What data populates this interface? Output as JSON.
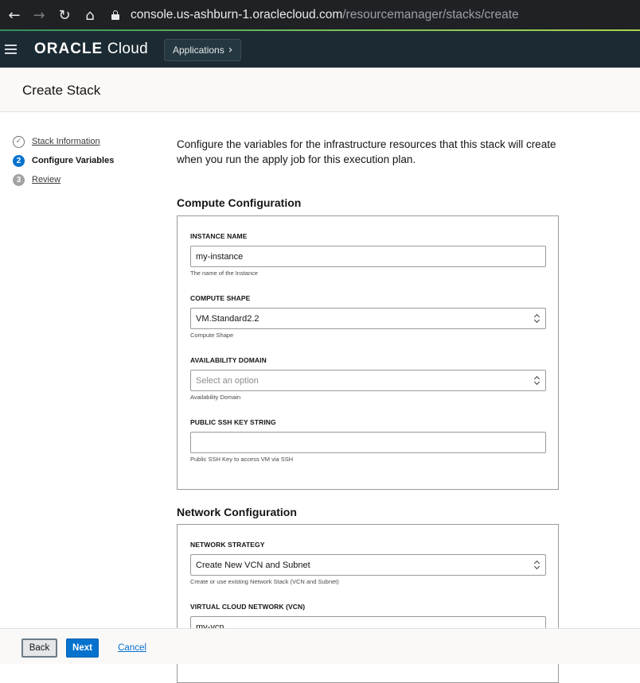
{
  "browser": {
    "back_icon": "←",
    "forward_icon": "→",
    "reload_icon": "↻",
    "home_icon": "⌂",
    "url_host": "console.us-ashburn-1.oraclecloud.com",
    "url_path": "/resourcemanager/stacks/create"
  },
  "header": {
    "brand": "ORACLE",
    "product": "Cloud",
    "applications_label": "Applications",
    "applications_chevron": "›"
  },
  "page": {
    "title": "Create Stack"
  },
  "steps": [
    {
      "number": "✓",
      "label": "Stack Information",
      "state": "completed"
    },
    {
      "number": "2",
      "label": "Configure Variables",
      "state": "active"
    },
    {
      "number": "3",
      "label": "Review",
      "state": "pending"
    }
  ],
  "intro": "Configure the variables for the infrastructure resources that this stack will create when you run the apply job for this execution plan.",
  "compute": {
    "section_title": "Compute Configuration",
    "instance_name": {
      "label": "INSTANCE NAME",
      "value": "my-instance",
      "help": "The name of the Instance"
    },
    "compute_shape": {
      "label": "COMPUTE SHAPE",
      "value": "VM.Standard2.2",
      "help": "Compute Shape"
    },
    "availability_domain": {
      "label": "AVAILABILITY DOMAIN",
      "placeholder": "Select an option",
      "help": "Availability Domain"
    },
    "ssh_key": {
      "label": "PUBLIC SSH KEY STRING",
      "value": "",
      "help": "Public SSH Key to access VM via SSH"
    }
  },
  "network": {
    "section_title": "Network Configuration",
    "strategy": {
      "label": "NETWORK STRATEGY",
      "value": "Create New VCN and Subnet",
      "help": "Create or use existing Network Stack (VCN and Subnet)"
    },
    "vcn": {
      "label": "VIRTUAL CLOUD NETWORK (VCN)",
      "value": "my-vcn"
    }
  },
  "footer": {
    "back_label": "Back",
    "next_label": "Next",
    "cancel_label": "Cancel"
  },
  "colors": {
    "header_bg": "#1c2b33",
    "accent": "#0572ce",
    "browser_bg": "#202124"
  }
}
